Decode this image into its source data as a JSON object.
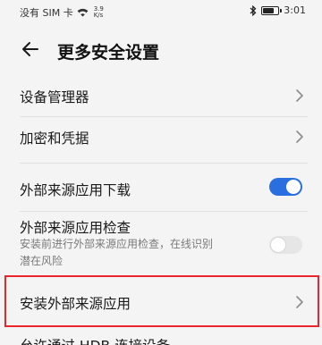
{
  "status_bar": {
    "carrier": "没有 SIM 卡",
    "speed_value": "3.9",
    "speed_unit": "K/s",
    "time": "3:01"
  },
  "header": {
    "title": "更多安全设置"
  },
  "settings": {
    "device_manager": "设备管理器",
    "encryption": "加密和凭据",
    "external_download": {
      "label": "外部来源应用下载",
      "enabled": true
    },
    "external_check": {
      "label": "外部来源应用检查",
      "desc_line1": "安装前进行外部来源应用检查，在线识别",
      "desc_line2": "潜在风险",
      "enabled": false
    },
    "install_external": "安装外部来源应用",
    "usb_partial": "允许通过 HDB 连接设备"
  }
}
